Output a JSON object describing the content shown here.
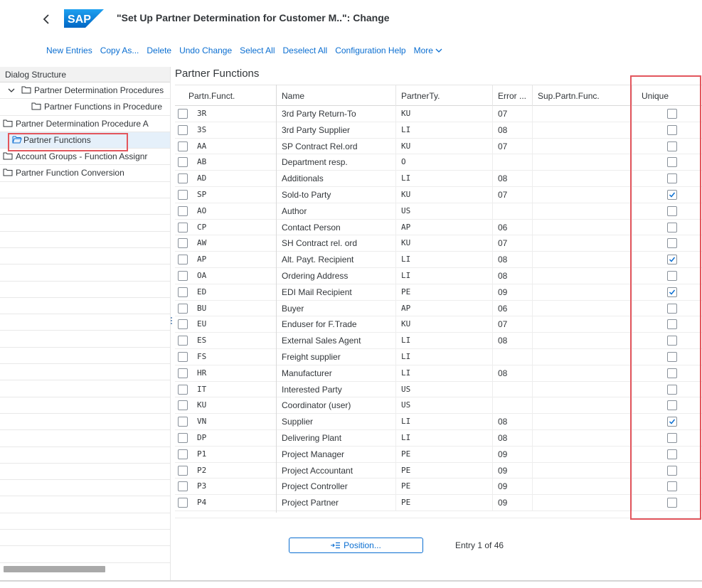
{
  "header": {
    "title": "\"Set Up Partner Determination for Customer M..\": Change",
    "logo_text": "SAP",
    "brand_color": "#0a6ed1"
  },
  "toolbar": {
    "new_entries": "New Entries",
    "copy_as": "Copy As...",
    "delete": "Delete",
    "undo_change": "Undo Change",
    "select_all": "Select All",
    "deselect_all": "Deselect All",
    "configuration_help": "Configuration Help",
    "more": "More"
  },
  "tree": {
    "header": "Dialog Structure",
    "items": [
      {
        "label": "Partner Determination Procedures",
        "expanded": true
      },
      {
        "label": "Partner Functions in Procedure"
      },
      {
        "label": "Partner Determination Procedure A"
      },
      {
        "label": "Partner Functions",
        "selected": true
      },
      {
        "label": "Account Groups - Function Assignr"
      },
      {
        "label": "Partner Function Conversion"
      }
    ]
  },
  "table": {
    "title": "Partner Functions",
    "columns": [
      "Partn.Funct.",
      "Name",
      "PartnerTy.",
      "Error ...",
      "Sup.Partn.Func.",
      "Unique"
    ],
    "rows": [
      {
        "funct": "3R",
        "name": "3rd Party Return-To",
        "type": "KU",
        "error": "07",
        "sup": "",
        "unique": false
      },
      {
        "funct": "3S",
        "name": "3rd Party Supplier",
        "type": "LI",
        "error": "08",
        "sup": "",
        "unique": false
      },
      {
        "funct": "AA",
        "name": "SP Contract Rel.ord",
        "type": "KU",
        "error": "07",
        "sup": "",
        "unique": false
      },
      {
        "funct": "AB",
        "name": "Department resp.",
        "type": "O",
        "error": "",
        "sup": "",
        "unique": false
      },
      {
        "funct": "AD",
        "name": "Additionals",
        "type": "LI",
        "error": "08",
        "sup": "",
        "unique": false
      },
      {
        "funct": "SP",
        "name": "Sold-to Party",
        "type": "KU",
        "error": "07",
        "sup": "",
        "unique": true
      },
      {
        "funct": "AO",
        "name": "Author",
        "type": "US",
        "error": "",
        "sup": "",
        "unique": false
      },
      {
        "funct": "CP",
        "name": "Contact Person",
        "type": "AP",
        "error": "06",
        "sup": "",
        "unique": false
      },
      {
        "funct": "AW",
        "name": "SH Contract rel. ord",
        "type": "KU",
        "error": "07",
        "sup": "",
        "unique": false
      },
      {
        "funct": "AP",
        "name": "Alt. Payt. Recipient",
        "type": "LI",
        "error": "08",
        "sup": "",
        "unique": true
      },
      {
        "funct": "OA",
        "name": "Ordering Address",
        "type": "LI",
        "error": "08",
        "sup": "",
        "unique": false
      },
      {
        "funct": "ED",
        "name": "EDI Mail Recipient",
        "type": "PE",
        "error": "09",
        "sup": "",
        "unique": true
      },
      {
        "funct": "BU",
        "name": "Buyer",
        "type": "AP",
        "error": "06",
        "sup": "",
        "unique": false
      },
      {
        "funct": "EU",
        "name": "Enduser for F.Trade",
        "type": "KU",
        "error": "07",
        "sup": "",
        "unique": false
      },
      {
        "funct": "ES",
        "name": "External Sales Agent",
        "type": "LI",
        "error": "08",
        "sup": "",
        "unique": false
      },
      {
        "funct": "FS",
        "name": "Freight supplier",
        "type": "LI",
        "error": "",
        "sup": "",
        "unique": false
      },
      {
        "funct": "HR",
        "name": "Manufacturer",
        "type": "LI",
        "error": "08",
        "sup": "",
        "unique": false
      },
      {
        "funct": "IT",
        "name": "Interested Party",
        "type": "US",
        "error": "",
        "sup": "",
        "unique": false
      },
      {
        "funct": "KU",
        "name": "Coordinator (user)",
        "type": "US",
        "error": "",
        "sup": "",
        "unique": false
      },
      {
        "funct": "VN",
        "name": "Supplier",
        "type": "LI",
        "error": "08",
        "sup": "",
        "unique": true
      },
      {
        "funct": "DP",
        "name": "Delivering Plant",
        "type": "LI",
        "error": "08",
        "sup": "",
        "unique": false
      },
      {
        "funct": "P1",
        "name": "Project Manager",
        "type": "PE",
        "error": "09",
        "sup": "",
        "unique": false
      },
      {
        "funct": "P2",
        "name": "Project Accountant",
        "type": "PE",
        "error": "09",
        "sup": "",
        "unique": false
      },
      {
        "funct": "P3",
        "name": "Project Controller",
        "type": "PE",
        "error": "09",
        "sup": "",
        "unique": false
      },
      {
        "funct": "P4",
        "name": "Project Partner",
        "type": "PE",
        "error": "09",
        "sup": "",
        "unique": false
      }
    ]
  },
  "footer": {
    "position_label": "Position...",
    "entry_text": "Entry 1 of 46"
  },
  "colors": {
    "highlight": "#e3565d",
    "link": "#0a6ed1",
    "selected_row": "#e5f0fa"
  }
}
